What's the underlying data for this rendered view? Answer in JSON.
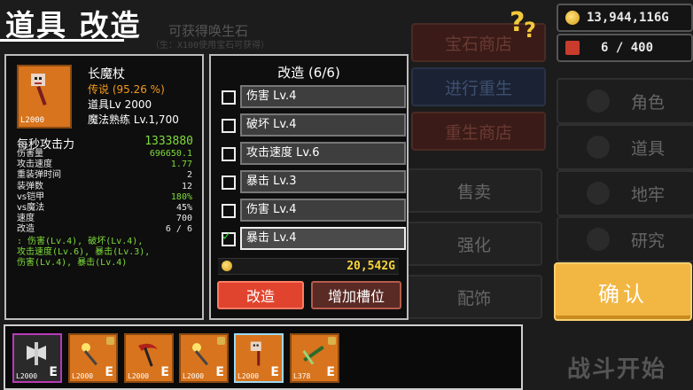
{
  "header": {
    "title": "道具 改造",
    "help_icon": "help-icon",
    "faded_hint": "可获得唤生石",
    "faded_hint_sub": "（生：X100使用宝石可获得）"
  },
  "currency": {
    "gold": "13,944,116G",
    "gems": "6 / 400"
  },
  "background_menu": {
    "gem_shop": "宝石商店",
    "rebirth": "进行重生",
    "rebirth_shop": "重生商店",
    "sell": "售卖",
    "enhance": "强化",
    "accessory": "配饰"
  },
  "side_menu": [
    "角色",
    "道具",
    "地牢",
    "研究"
  ],
  "confirm_label": "确认",
  "battle_label": "战斗开始",
  "item": {
    "level_tag": "L2000",
    "name": "长魔杖",
    "rarity": "传说 (95.26 %)",
    "item_level": "道具Lv 2000",
    "mastery": "魔法熟练 Lv.1,700",
    "dps_label": "每秒攻击力",
    "dps_value": "1333880",
    "stats": [
      {
        "label": "伤害量",
        "value": "696650.1"
      },
      {
        "label": "攻击速度",
        "value": "1.77"
      },
      {
        "label": "重装弹时间",
        "value": "2"
      },
      {
        "label": "装弹数",
        "value": "12"
      },
      {
        "label": "vs铠甲",
        "value": "180%"
      },
      {
        "label": "vs魔法",
        "value": "45%"
      },
      {
        "label": "速度",
        "value": "700"
      },
      {
        "label": "改造",
        "value": "6 / 6"
      }
    ],
    "mods_text": ": 伤害(Lv.4), 破坏(Lv.4),\n攻击速度(Lv.6), 暴击(Lv.3),\n伤害(Lv.4), 暴击(Lv.4)"
  },
  "modify": {
    "title": "改造 (6/6)",
    "rows": [
      {
        "label": "伤害 Lv.4",
        "checked": false
      },
      {
        "label": "破坏 Lv.4",
        "checked": false
      },
      {
        "label": "攻击速度 Lv.6",
        "checked": false
      },
      {
        "label": "暴击 Lv.3",
        "checked": false
      },
      {
        "label": "伤害 Lv.4",
        "checked": false
      },
      {
        "label": "暴击 Lv.4",
        "checked": true
      }
    ],
    "cost": "20,542G",
    "modify_button": "改造",
    "add_slot_button": "增加槽位"
  },
  "inventory": [
    {
      "level": "L2000",
      "equip": "E",
      "locked": false,
      "frame": "#b83ab8",
      "bg": "#2a2a2a",
      "icon": "axe-icon"
    },
    {
      "level": "L2000",
      "equip": "E",
      "locked": true,
      "frame": "#d8741d",
      "bg": "#d8741d",
      "icon": "wand-icon"
    },
    {
      "level": "L2000",
      "equip": "E",
      "locked": false,
      "frame": "#d8741d",
      "bg": "#d8741d",
      "icon": "scythe-icon"
    },
    {
      "level": "L2000",
      "equip": "E",
      "locked": true,
      "frame": "#d8741d",
      "bg": "#d8741d",
      "icon": "wand-icon"
    },
    {
      "level": "L2000",
      "equip": "E",
      "locked": false,
      "frame": "#9fd8f0",
      "bg": "#d8741d",
      "icon": "staff-icon"
    },
    {
      "level": "L378",
      "equip": "E",
      "locked": true,
      "frame": "#d8741d",
      "bg": "#d8741d",
      "icon": "crossbow-icon"
    }
  ]
}
